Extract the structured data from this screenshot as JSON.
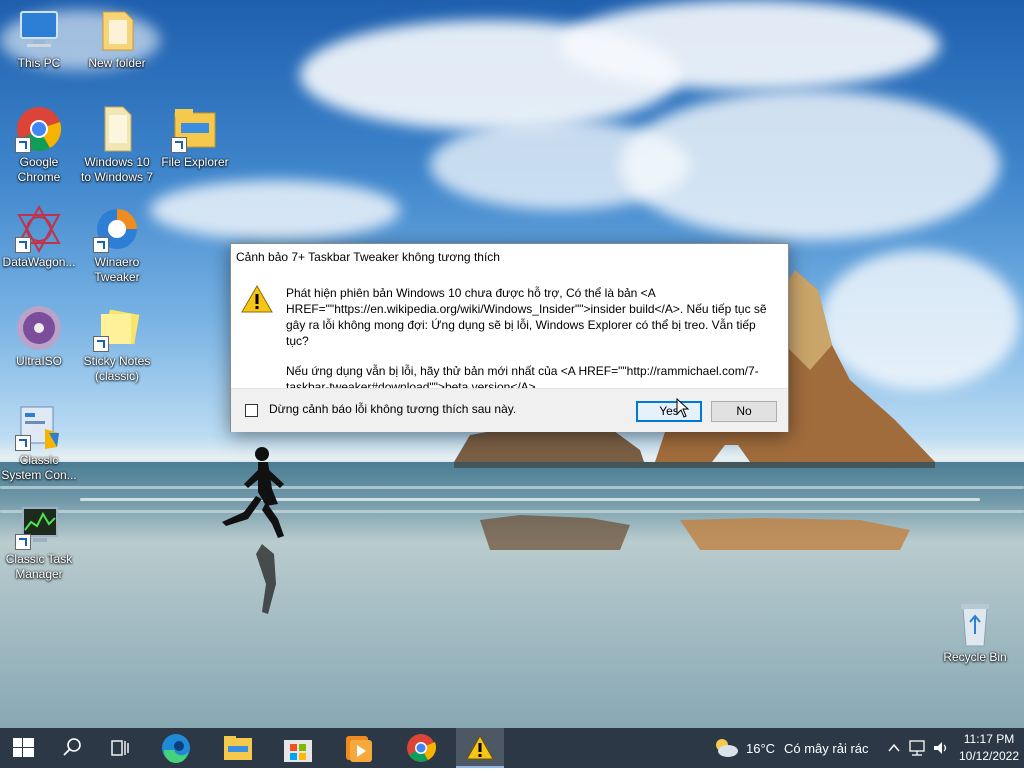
{
  "desktop_icons": [
    {
      "name": "this-pc",
      "label": "This PC"
    },
    {
      "name": "new-folder",
      "label": "New folder"
    },
    {
      "name": "google-chrome",
      "label": "Google Chrome"
    },
    {
      "name": "windows10-to-windows7",
      "label": "Windows 10 to Windows 7"
    },
    {
      "name": "file-explorer",
      "label": "File Explorer"
    },
    {
      "name": "datawagon",
      "label": "DataWagon..."
    },
    {
      "name": "winaero-tweaker",
      "label": "Winaero Tweaker"
    },
    {
      "name": "ultraiso",
      "label": "UltraISO"
    },
    {
      "name": "sticky-notes",
      "label": "Sticky Notes (classic)"
    },
    {
      "name": "classic-system-con",
      "label": "Classic System Con..."
    },
    {
      "name": "classic-task-manager",
      "label": "Classic Task Manager"
    },
    {
      "name": "recycle-bin",
      "label": "Recycle Bin"
    }
  ],
  "dialog": {
    "title": "Cảnh bảo 7+ Taskbar Tweaker không tương thích",
    "message1": "Phát hiện phiên bản Windows 10 chưa được hỗ trợ, Có thể là bản <A HREF=\"\"https://en.wikipedia.org/wiki/Windows_Insider\"\">insider build</A>.  Nếu tiếp tục sẽ gây ra lỗi không mong đợi: Ứng dụng sẽ bị lỗi, Windows Explorer có thể bị treo. Vẫn tiếp tục?",
    "message2": "Nếu ứng dụng vẫn bị lỗi, hãy thử bản mới nhất của <A HREF=\"\"http://rammichael.com/7-taskbar-tweaker#download\"\">beta version</A>.",
    "checkbox_label": "Dừng cảnh báo lỗi không tương thích sau này.",
    "yes_label": "Yes",
    "no_label": "No"
  },
  "taskbar": {
    "weather_temp": "16°C",
    "weather_desc": "Có mây rải rác",
    "time": "11:17 PM",
    "date": "10/12/2022"
  },
  "colors": {
    "accent": "#0078d7",
    "taskbar": "#101c2d"
  }
}
